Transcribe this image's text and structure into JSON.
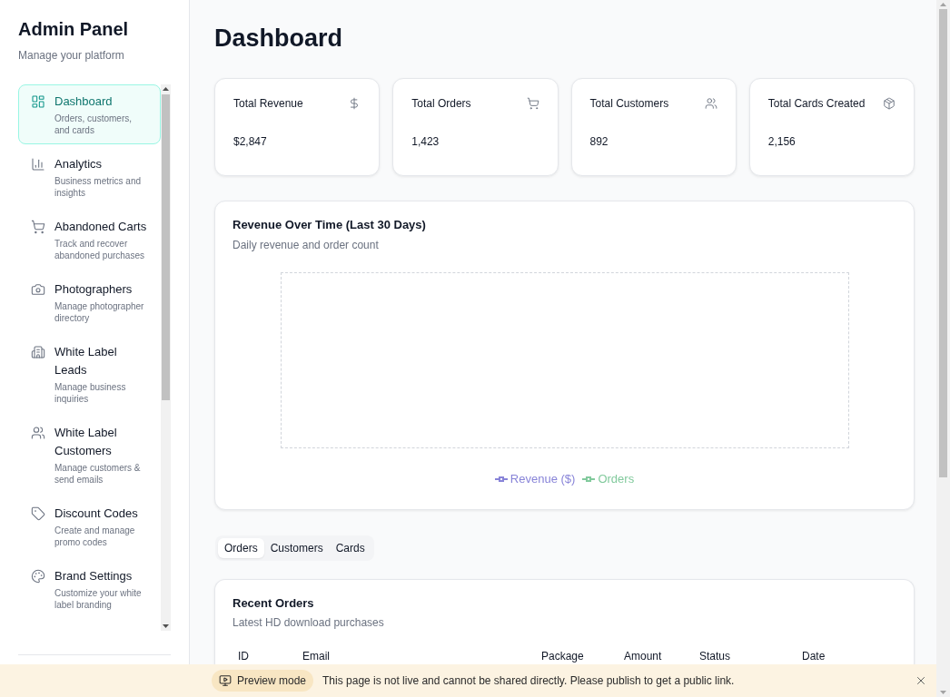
{
  "sidebar": {
    "title": "Admin Panel",
    "subtitle": "Manage your platform",
    "items": [
      {
        "label": "Dashboard",
        "description": "Orders, customers, and cards",
        "selected": true
      },
      {
        "label": "Analytics",
        "description": "Business metrics and insights",
        "selected": false
      },
      {
        "label": "Abandoned Carts",
        "description": "Track and recover abandoned purchases",
        "selected": false
      },
      {
        "label": "Photographers",
        "description": "Manage photographer directory",
        "selected": false
      },
      {
        "label": "White Label Leads",
        "description": "Manage business inquiries",
        "selected": false
      },
      {
        "label": "White Label Customers",
        "description": "Manage customers & send emails",
        "selected": false
      },
      {
        "label": "Discount Codes",
        "description": "Create and manage promo codes",
        "selected": false
      },
      {
        "label": "Brand Settings",
        "description": "Customize your white label branding",
        "selected": false
      }
    ]
  },
  "page_title": "Dashboard",
  "stats": [
    {
      "label": "Total Revenue",
      "value": "$2,847"
    },
    {
      "label": "Total Orders",
      "value": "1,423"
    },
    {
      "label": "Total Customers",
      "value": "892"
    },
    {
      "label": "Total Cards Created",
      "value": "2,156"
    }
  ],
  "revenue_chart": {
    "title": "Revenue Over Time (Last 30 Days)",
    "subtitle": "Daily revenue and order count",
    "legend": [
      {
        "label": "Revenue ($)",
        "color": "#8884d8"
      },
      {
        "label": "Orders",
        "color": "#82ca9d"
      }
    ]
  },
  "tabs": [
    {
      "label": "Orders",
      "selected": true
    },
    {
      "label": "Customers",
      "selected": false
    },
    {
      "label": "Cards",
      "selected": false
    }
  ],
  "recent_orders": {
    "title": "Recent Orders",
    "subtitle": "Latest HD download purchases",
    "columns": [
      "ID",
      "Email",
      "Package",
      "Amount",
      "Status",
      "Date"
    ]
  },
  "preview_banner": {
    "badge": "Preview mode",
    "message": "This page is not live and cannot be shared directly. Please publish to get a public link."
  }
}
